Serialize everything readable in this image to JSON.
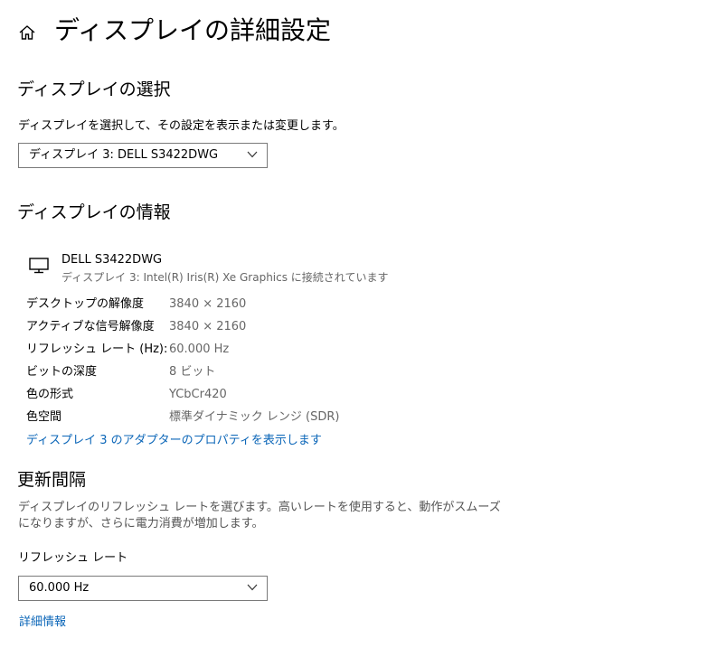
{
  "header": {
    "title": "ディスプレイの詳細設定"
  },
  "display_select": {
    "heading": "ディスプレイの選択",
    "description": "ディスプレイを選択して、その設定を表示または変更します。",
    "selected": "ディスプレイ 3: DELL S3422DWG"
  },
  "display_info": {
    "heading": "ディスプレイの情報",
    "monitor_name": "DELL S3422DWG",
    "monitor_connection": "ディスプレイ 3: Intel(R) Iris(R) Xe Graphics に接続されています",
    "rows": [
      {
        "label": "デスクトップの解像度",
        "value": "3840 × 2160"
      },
      {
        "label": "アクティブな信号解像度",
        "value": "3840 × 2160"
      },
      {
        "label": "リフレッシュ レート (Hz):",
        "value": "60.000 Hz"
      },
      {
        "label": "ビットの深度",
        "value": "8 ビット"
      },
      {
        "label": "色の形式",
        "value": "YCbCr420"
      },
      {
        "label": "色空間",
        "value": "標準ダイナミック レンジ (SDR)"
      }
    ],
    "adapter_link": "ディスプレイ 3 のアダプターのプロパティを表示します"
  },
  "refresh": {
    "heading": "更新間隔",
    "description_line1": "ディスプレイのリフレッシュ レートを選びます。高いレートを使用すると、動作がスムーズ",
    "description_line2": "になりますが、さらに電力消費が増加します。",
    "field_label": "リフレッシュ レート",
    "selected": "60.000 Hz",
    "details_link": "詳細情報"
  },
  "colors": {
    "link": "#0b66b8",
    "border": "#7a7a7a",
    "muted_text": "#666666"
  },
  "icons": {
    "home": "home-icon",
    "monitor": "monitor-icon",
    "chevron": "chevron-down-icon"
  }
}
